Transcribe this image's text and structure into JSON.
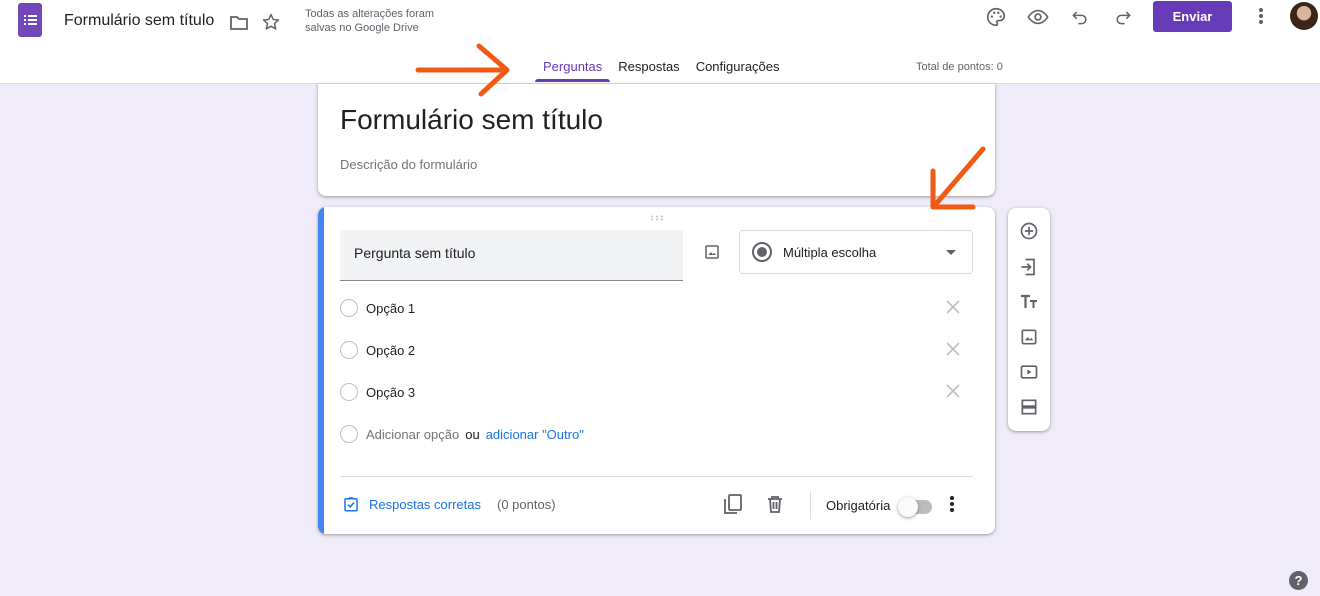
{
  "header": {
    "doc_title": "Formulário sem título",
    "save_status": "Todas as alterações foram salvas no Google Drive",
    "send_label": "Enviar",
    "icons": [
      "forms-logo-icon",
      "folder-icon",
      "star-icon",
      "palette-icon",
      "eye-icon",
      "undo-icon",
      "redo-icon",
      "more-vert-icon",
      "avatar"
    ]
  },
  "tabs": [
    {
      "label": "Perguntas",
      "active": true
    },
    {
      "label": "Respostas",
      "active": false
    },
    {
      "label": "Configurações",
      "active": false
    }
  ],
  "total_points": "Total de pontos: 0",
  "form": {
    "title": "Formulário sem título",
    "description": "Descrição do formulário"
  },
  "question": {
    "title": "Pergunta sem título",
    "type": "Múltipla escolha",
    "options": [
      "Opção 1",
      "Opção 2",
      "Opção 3"
    ],
    "add_option": "Adicionar opção",
    "or": "ou",
    "add_other": "adicionar \"Outro\"",
    "answer_key": "Respostas corretas",
    "points": "(0 pontos)",
    "required_label": "Obrigatória",
    "required": false
  },
  "colors": {
    "accent": "#673ab7",
    "background": "#f0ebf8",
    "question_bar": "#4285f4",
    "link": "#1a73e8",
    "annotation_arrow": "#f05a14"
  }
}
